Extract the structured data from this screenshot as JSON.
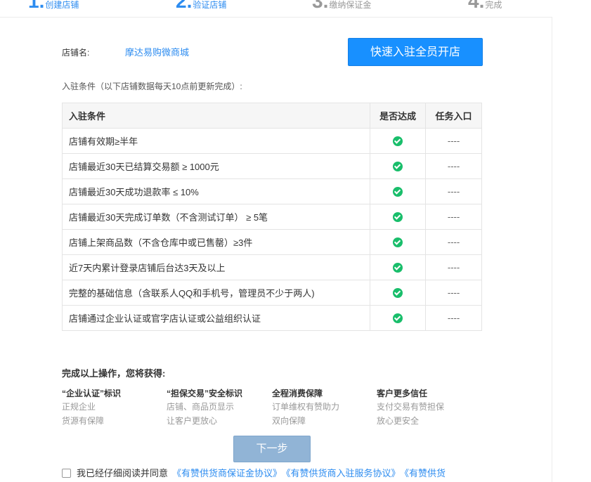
{
  "steps": [
    {
      "num": "1.",
      "label": "创建店铺"
    },
    {
      "num": "2.",
      "label": "验证店铺"
    },
    {
      "num": "3.",
      "label": "缴纳保证金"
    },
    {
      "num": "4.",
      "label": "完成"
    }
  ],
  "shop": {
    "label": "店铺名:",
    "name": "摩达易购微商城",
    "open_button": "快速入驻全员开店"
  },
  "conditions": {
    "intro": "入驻条件（以下店铺数据每天10点前更新完成）:",
    "headers": [
      "入驻条件",
      "是否达成",
      "任务入口"
    ],
    "rows": [
      {
        "text": "店铺有效期≥半年",
        "met": true,
        "entry": "----"
      },
      {
        "text": "店铺最近30天已结算交易额 ≥ 1000元",
        "met": true,
        "entry": "----"
      },
      {
        "text": "店铺最近30天成功退款率 ≤ 10%",
        "met": true,
        "entry": "----"
      },
      {
        "text": "店铺最近30天完成订单数（不含测试订单） ≥ 5笔",
        "met": true,
        "entry": "----"
      },
      {
        "text": "店铺上架商品数（不含仓库中或已售罄）≥3件",
        "met": true,
        "entry": "----"
      },
      {
        "text": "近7天内累计登录店铺后台达3天及以上",
        "met": true,
        "entry": "----"
      },
      {
        "text": "完整的基础信息（含联系人QQ和手机号，管理员不少于两人)",
        "met": true,
        "entry": "----"
      },
      {
        "text": "店铺通过企业认证或官字店认证或公益组织认证",
        "met": true,
        "entry": "----"
      }
    ]
  },
  "benefits": {
    "title": "完成以上操作，您将获得:",
    "items": [
      {
        "title": "“企业认证”标识",
        "lines": [
          "正规企业",
          "货源有保障"
        ]
      },
      {
        "title": "“担保交易”安全标识",
        "lines": [
          "店铺、商品页显示",
          "让客户更放心"
        ]
      },
      {
        "title": "全程消费保障",
        "lines": [
          "订单维权有赞助力",
          "双向保障"
        ]
      },
      {
        "title": "客户更多信任",
        "lines": [
          "支付交易有赞担保",
          "放心更安全"
        ]
      }
    ]
  },
  "next_button": "下一步",
  "agreement": {
    "prefix": "我已经仔细阅读并同意",
    "links": [
      "《有赞供货商保证金协议》",
      "《有赞供货商入驻服务协议》",
      "《有赞供货"
    ]
  },
  "colors": {
    "accent": "#1890ff",
    "success": "#19be6b",
    "link": "#2d8cf0"
  }
}
